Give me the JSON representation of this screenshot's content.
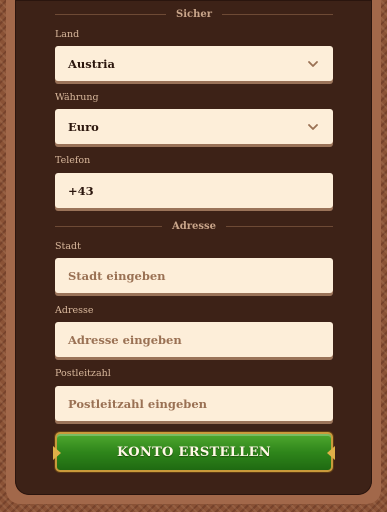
{
  "sections": {
    "secure_label": "Sicher",
    "address_label": "Adresse"
  },
  "country": {
    "label": "Land",
    "value": "Austria"
  },
  "currency": {
    "label": "Währung",
    "value": "Euro"
  },
  "phone": {
    "label": "Telefon",
    "value": "+43"
  },
  "city": {
    "label": "Stadt",
    "placeholder": "Stadt eingeben"
  },
  "street": {
    "label": "Adresse",
    "placeholder": "Adresse eingeben"
  },
  "postal": {
    "label": "Postleitzahl",
    "placeholder": "Postleitzahl eingeben"
  },
  "submit": {
    "label": "KONTO ERSTELLEN"
  },
  "colors": {
    "panel_bg": "#3d2217",
    "field_bg": "#fdeed9",
    "button_green": "#2f861b",
    "button_border": "#c99a3b"
  },
  "icons": {
    "dropdown": "chevron-down-icon"
  }
}
